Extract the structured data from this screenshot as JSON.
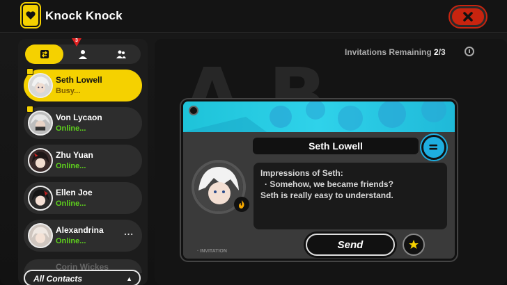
{
  "app": {
    "title": "Knock Knock",
    "close_icon": "close-x-icon",
    "phone_icon": "phone-heart-icon"
  },
  "tabs": [
    {
      "icon": "chat-swap-icon",
      "active": true
    },
    {
      "icon": "person-icon",
      "active": false,
      "badge": "3"
    },
    {
      "icon": "group-icon",
      "active": false
    }
  ],
  "contacts": [
    {
      "name": "Seth Lowell",
      "status": "Busy...",
      "active": true,
      "pinned": true
    },
    {
      "name": "Von Lycaon",
      "status": "Online...",
      "active": false,
      "pinned": true
    },
    {
      "name": "Zhu Yuan",
      "status": "Online...",
      "active": false,
      "pinned": false
    },
    {
      "name": "Ellen Joe",
      "status": "Online...",
      "active": false,
      "pinned": false
    },
    {
      "name": "Alexandrina",
      "status": "Online...",
      "active": false,
      "pinned": false,
      "more": "..."
    }
  ],
  "partial_contact": {
    "name": "Corin Wickes"
  },
  "all_contacts": {
    "label": "All Contacts",
    "arrow": "▲"
  },
  "invitations": {
    "label": "Invitations Remaining",
    "used": "2",
    "total": "/3"
  },
  "card": {
    "name": "Seth Lowell",
    "impression_title": "Impressions of Seth:",
    "impression_bullet": "· Somehow, we became friends?",
    "impression_line": "Seth is really easy to understand.",
    "send_label": "Send",
    "invitation_label": "· INVITATION",
    "accent_color": "#1ec3d9"
  },
  "colors": {
    "accent_yellow": "#f5d100",
    "online_green": "#5fd31d",
    "close_red": "#c8240f"
  }
}
